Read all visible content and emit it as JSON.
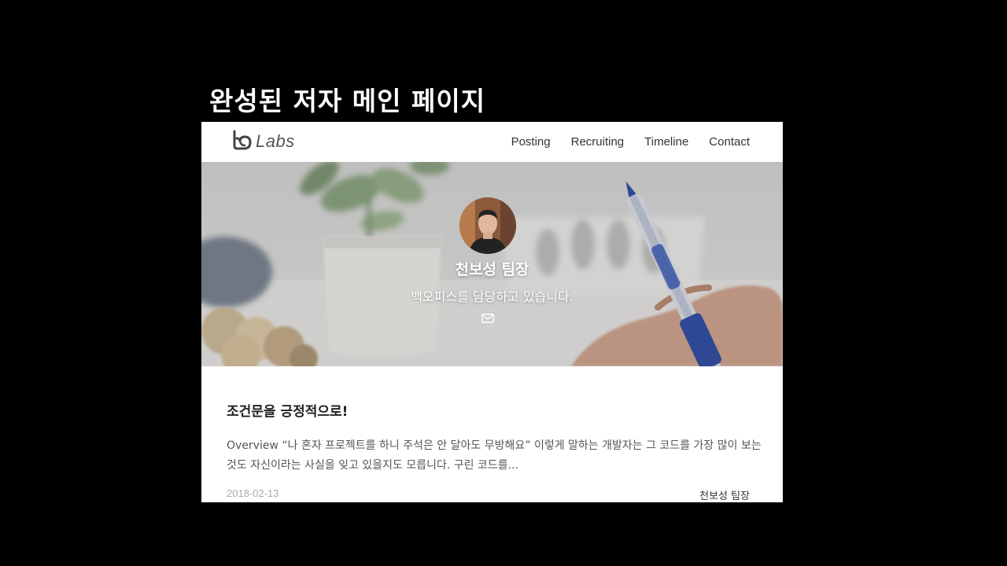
{
  "slide": {
    "title": "완성된 저자 메인 페이지"
  },
  "header": {
    "logo_text": "Labs",
    "nav": [
      {
        "label": "Posting"
      },
      {
        "label": "Recruiting"
      },
      {
        "label": "Timeline"
      },
      {
        "label": "Contact"
      }
    ]
  },
  "profile": {
    "name": "천보성 팀장",
    "description": "백오피스를 담당하고 있습니다.",
    "contact_icon": "mail-icon"
  },
  "post": {
    "title": "조건문을 긍정적으로!",
    "excerpt": "Overview “나 혼자 프로젝트를 하니 주석은 안 달아도 무방해요” 이렇게 말하는 개발자는 그 코드를 가장 많이 보는 것도 자신이라는 사실을 잊고 있을지도 모릅니다. 구린 코드를...",
    "date": "2018-02-13",
    "author": "천보성 팀장"
  },
  "colors": {
    "background": "#000000",
    "page": "#ffffff",
    "text": "#333333",
    "muted": "#aaaaaa",
    "pen_accent": "#1f3e9a"
  }
}
